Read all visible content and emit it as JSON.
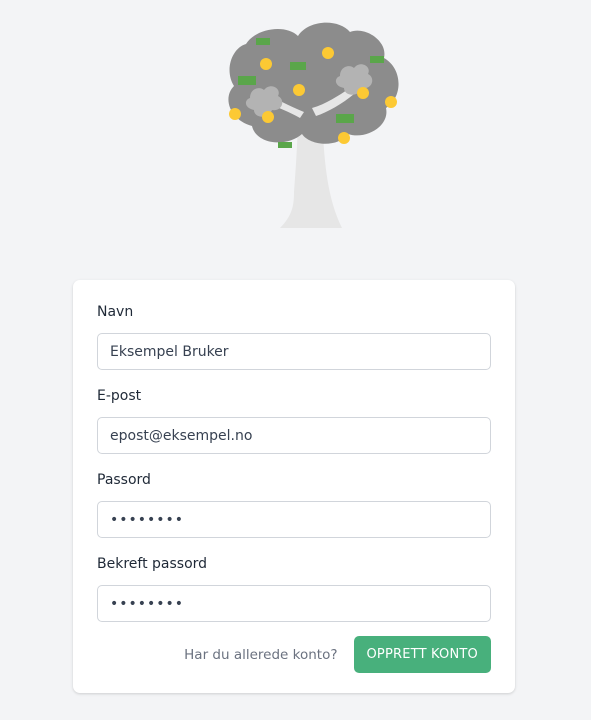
{
  "form": {
    "name": {
      "label": "Navn",
      "value": "Eksempel Bruker"
    },
    "email": {
      "label": "E-post",
      "value": "epost@eksempel.no"
    },
    "password": {
      "label": "Passord",
      "value": "••••••••"
    },
    "confirm_password": {
      "label": "Bekreft passord",
      "value": "••••••••"
    },
    "login_link": "Har du allerede konto?",
    "submit_label": "OPPRETT KONTO"
  },
  "colors": {
    "background": "#f3f4f6",
    "accent": "#48b07c",
    "tree_foliage": "#8c8c8c",
    "tree_trunk": "#e6e6e6",
    "fruit": "#fcc934",
    "leaf": "#5aa64a"
  },
  "icons": {
    "logo": "money-tree-logo"
  }
}
